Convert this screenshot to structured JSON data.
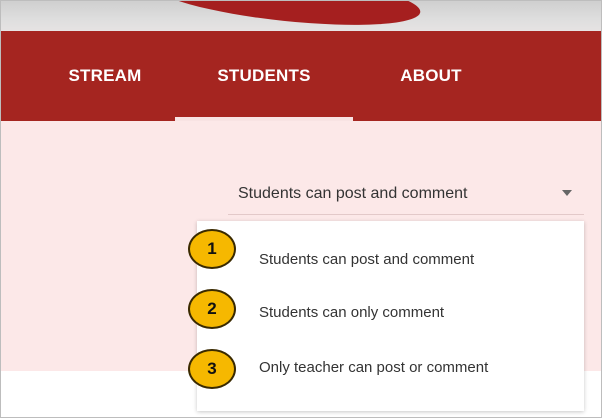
{
  "nav": {
    "tabs": [
      {
        "label": "STREAM"
      },
      {
        "label": "STUDENTS",
        "active": true
      },
      {
        "label": "ABOUT"
      }
    ]
  },
  "permission_select": {
    "selected": "Students can post and comment",
    "options": [
      {
        "number": "1",
        "label": "Students can post and comment"
      },
      {
        "number": "2",
        "label": "Students can only comment"
      },
      {
        "number": "3",
        "label": "Only teacher can post or comment"
      }
    ]
  },
  "colors": {
    "nav_background": "#a52520",
    "content_background": "#fce8e8",
    "badge_fill": "#f6b800"
  }
}
